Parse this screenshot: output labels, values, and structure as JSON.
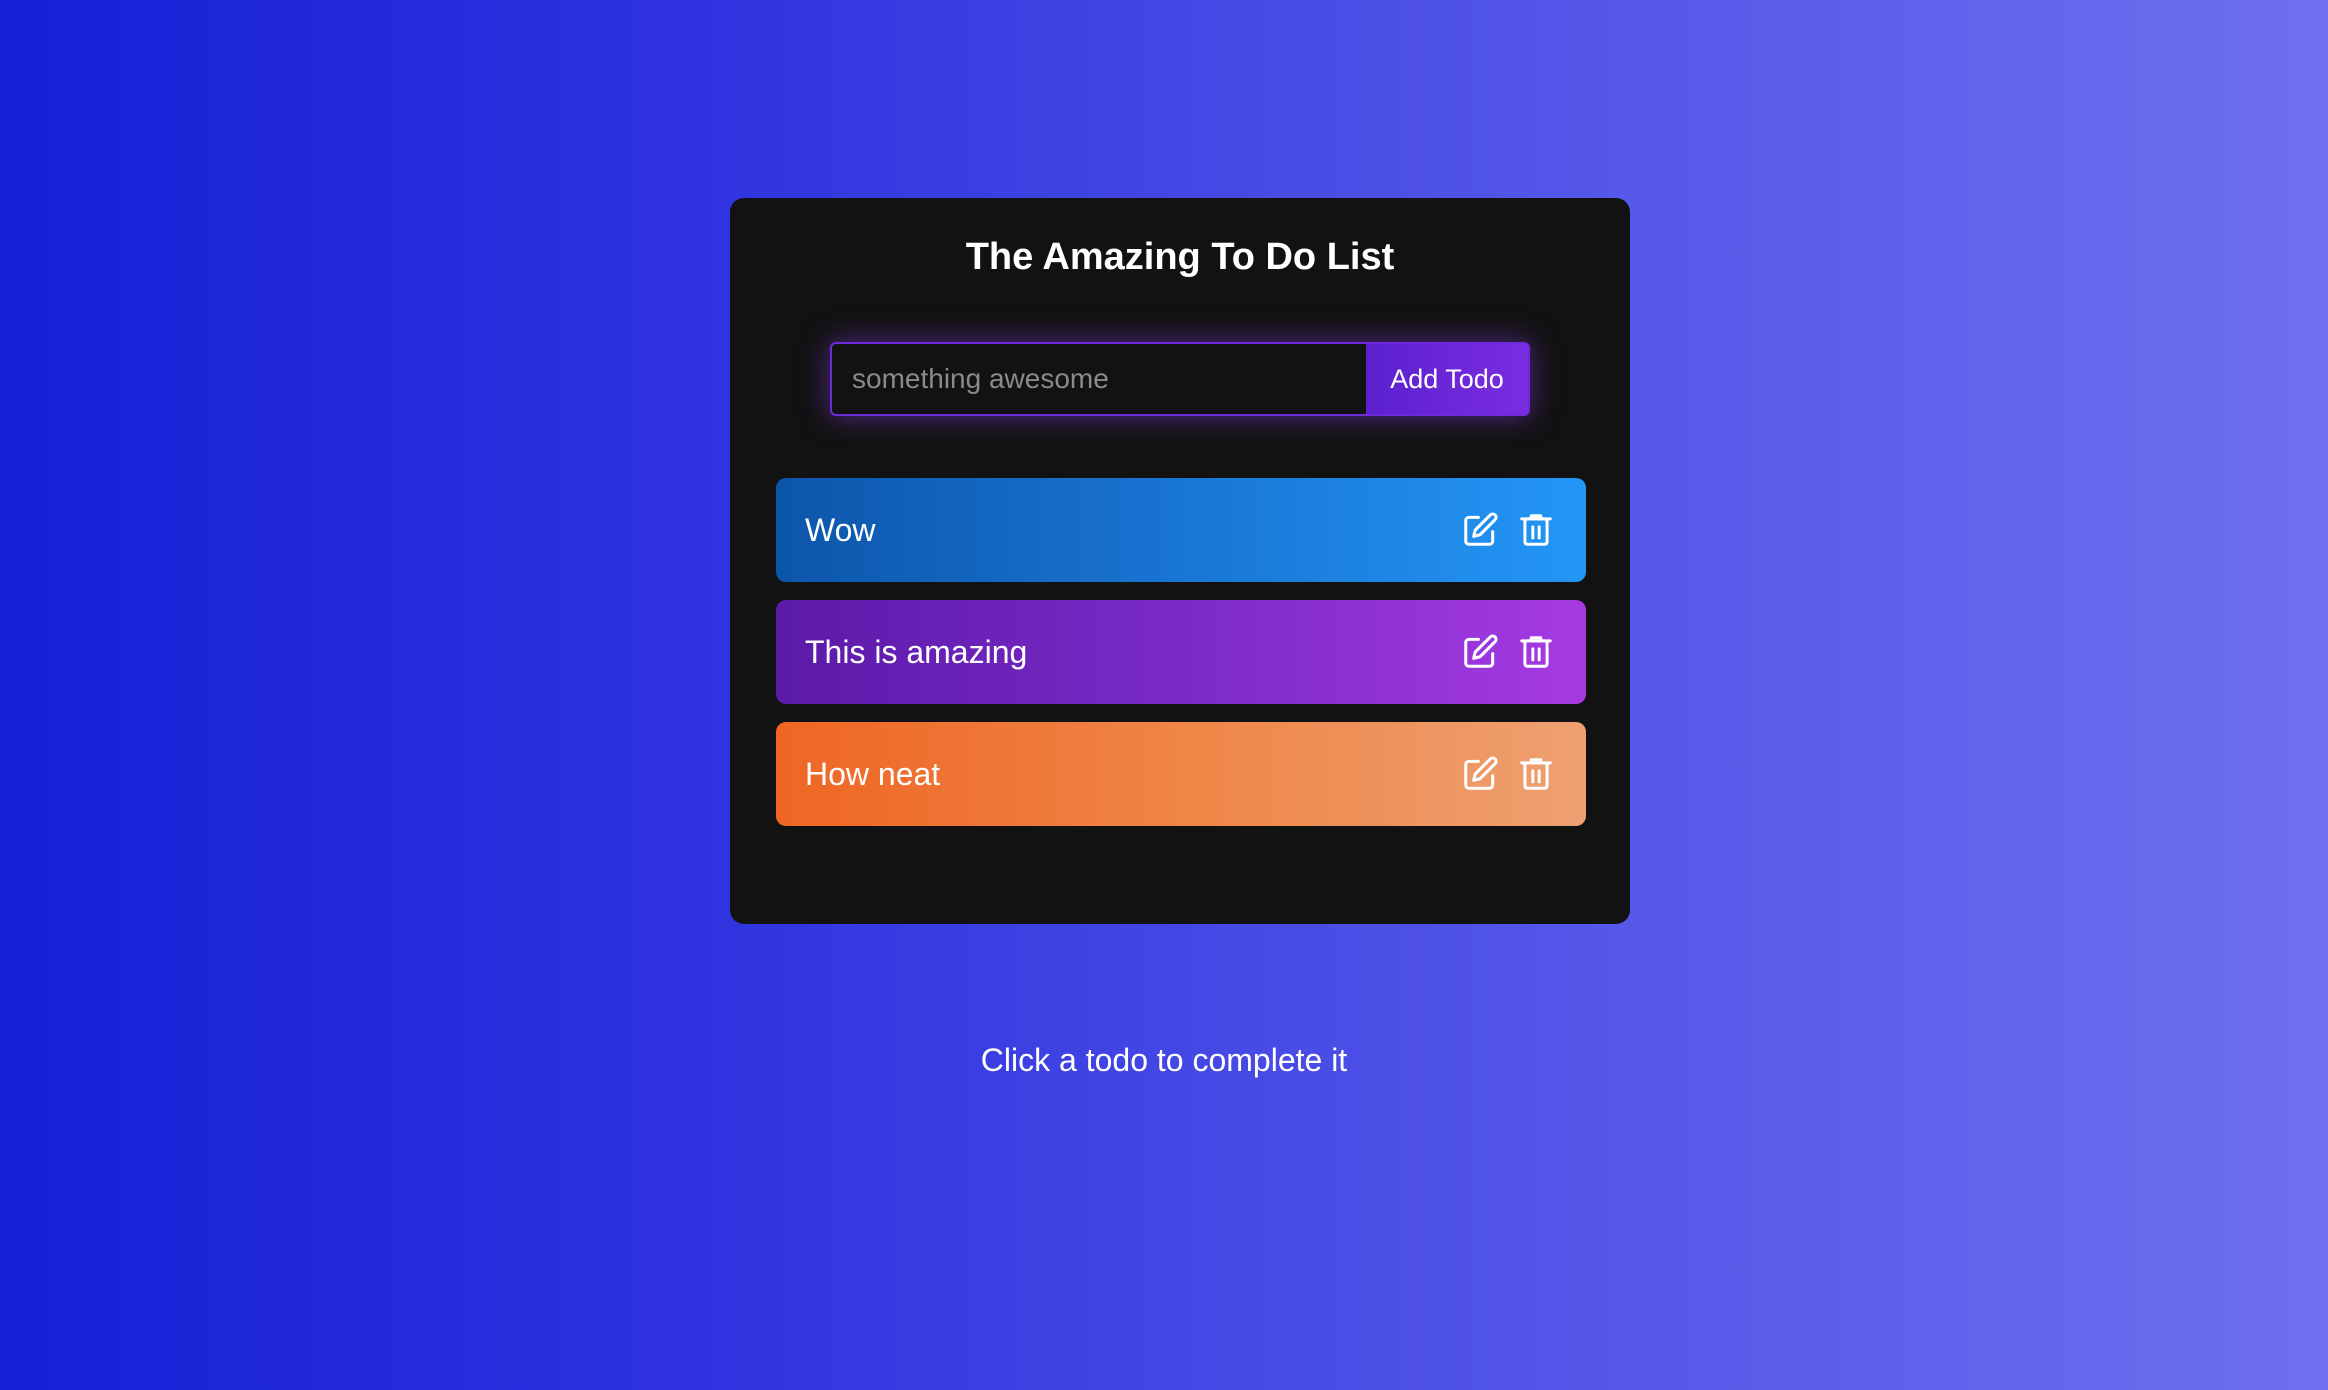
{
  "app": {
    "title": "The Amazing To Do List"
  },
  "form": {
    "input_value": "",
    "input_placeholder": "something awesome",
    "add_button_label": "Add Todo"
  },
  "todos": [
    {
      "text": "Wow",
      "color": "#1872cf",
      "edit_icon": "edit-icon",
      "delete_icon": "trash-icon"
    },
    {
      "text": "This is amazing",
      "color": "#7a2ac7",
      "edit_icon": "edit-icon",
      "delete_icon": "trash-icon"
    },
    {
      "text": "How neat",
      "color": "#ef8546",
      "edit_icon": "edit-icon",
      "delete_icon": "trash-icon"
    }
  ],
  "footer": {
    "hint": "Click a todo to complete it"
  },
  "theme": {
    "background_start": "#1520d6",
    "background_end": "#6e70ef",
    "card": "#121212",
    "accent": "#6d2bd9"
  }
}
